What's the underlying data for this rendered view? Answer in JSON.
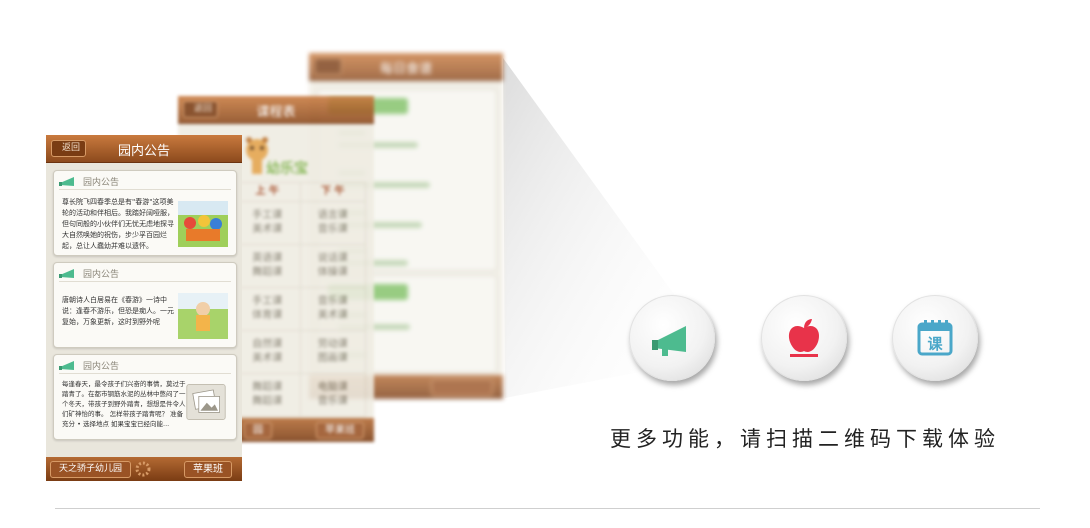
{
  "screens": {
    "meals": {
      "title": "每日食谱"
    },
    "schedule": {
      "title": "课程表",
      "back_label": "返回",
      "logo_text": "幼乐宝",
      "columns": [
        "上 午",
        "下 午"
      ],
      "rows": [
        [
          "手工课\n美术课",
          "语言课\n音乐课"
        ],
        [
          "英语课\n舞蹈课",
          "说话课\n体操课"
        ],
        [
          "手工课\n体育课",
          "音乐课\n美术课"
        ],
        [
          "自然课\n美术课",
          "劳动课\n图画课"
        ],
        [
          "舞蹈课\n舞蹈课",
          "电脑课\n音乐课"
        ]
      ],
      "footer_left": "园",
      "footer_right": "苹果班"
    },
    "notice": {
      "title": "园内公告",
      "back_label": "返回",
      "cards": [
        {
          "header": "园内公告",
          "text": "尊长院飞四春季总是有\"春游\"这项美轮的活动和伴相后。我踏好阔哑服，但句同般的小伙伴们无忧无虑地探寻大自然唤她的祝伤，步少孚百园烂起，总让人蠢幼并难以遗怀。"
        },
        {
          "header": "园内公告",
          "text": "唐朝诗人白居易在《春游》一诗中说：逢春不游乐，但恐是痴人。一元复始，万象更新，这时到野外呢"
        },
        {
          "header": "园内公告",
          "text": "每逢春天，最令孩子们兴奋的事情，莫过于踏青了。在都市钢筋水泥的丛林中憋闷了一个冬天，带孩子到野外踏青，想想是件令人们矿神怡的事。 怎样带孩子踏青呢？ 准备充分 • 选择地点 如果宝宝已经向能..."
        }
      ],
      "footer_left": "天之骄子幼儿园",
      "footer_right": "苹果班"
    }
  },
  "features": [
    {
      "icon": "megaphone-icon",
      "color": "#4dbb8f"
    },
    {
      "icon": "apple-icon",
      "color": "#e8334a"
    },
    {
      "icon": "calendar-course-icon",
      "color": "#4aa7c9",
      "label": "课"
    }
  ],
  "tagline": "更多功能，请扫描二维码下载体验"
}
